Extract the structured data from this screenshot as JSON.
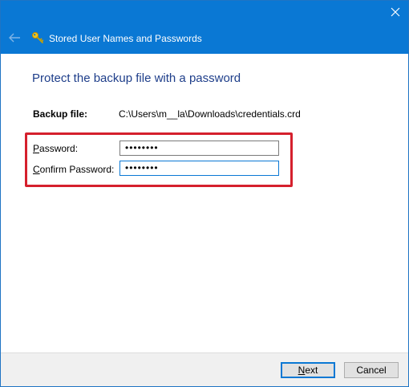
{
  "window": {
    "title": "Stored User Names and Passwords"
  },
  "page": {
    "heading": "Protect the backup file with a password"
  },
  "backup": {
    "label": "Backup file:",
    "path": "C:\\Users\\m__la\\Downloads\\credentials.crd"
  },
  "password": {
    "label_mnemonic": "P",
    "label_rest": "assword:",
    "value": "••••••••"
  },
  "confirm": {
    "label_mnemonic": "C",
    "label_rest": "onfirm Password:",
    "value": "••••••••"
  },
  "buttons": {
    "next_mnemonic": "N",
    "next_rest": "ext",
    "cancel": "Cancel"
  },
  "colors": {
    "titlebar": "#0a78d4",
    "heading": "#1e3e8a",
    "highlight": "#d5202d"
  },
  "icons": {
    "back": "back-arrow-icon",
    "app": "key-icon",
    "close": "close-icon"
  }
}
